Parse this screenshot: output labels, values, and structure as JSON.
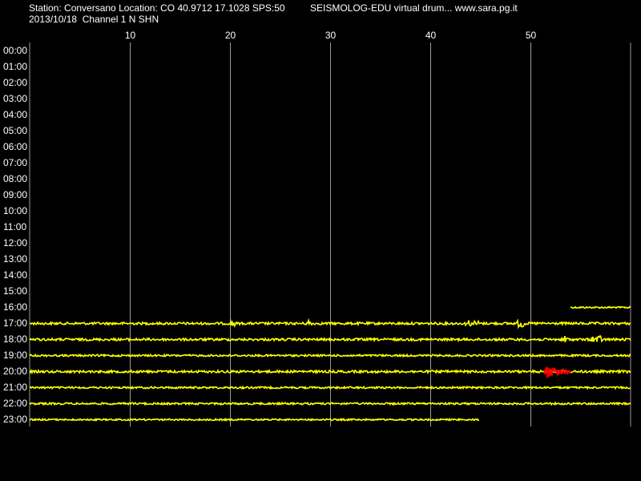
{
  "header": {
    "station_line": "Station: Conversano Location: CO 40.9712 17.1028 SPS:50",
    "date_line": "2013/10/18  Channel 1 N SHN",
    "brand_line": "SEISMOLOG-EDU virtual drum... www.sara.pg.it"
  },
  "colors": {
    "background": "#000000",
    "trace": "#ffff00",
    "event": "#ff0000",
    "grid": "#9a9a9a",
    "text": "#ffffff"
  },
  "chart_data": {
    "type": "line",
    "x_ticks": [
      10,
      20,
      30,
      40,
      50
    ],
    "xlim": [
      0,
      60
    ],
    "hours": [
      "00:00",
      "01:00",
      "02:00",
      "03:00",
      "04:00",
      "05:00",
      "06:00",
      "07:00",
      "08:00",
      "09:00",
      "10:00",
      "11:00",
      "12:00",
      "13:00",
      "14:00",
      "15:00",
      "16:00",
      "17:00",
      "18:00",
      "19:00",
      "20:00",
      "21:00",
      "22:00",
      "23:00"
    ],
    "traces": [
      {
        "hour": "16:00",
        "start": 54.0,
        "end": 60,
        "amplitude": 1.0,
        "spikes": []
      },
      {
        "hour": "17:00",
        "start": 0,
        "end": 60,
        "amplitude": 1.5,
        "spikes": [
          20.3,
          27.9,
          43.8,
          44.6,
          48.9,
          49.2
        ]
      },
      {
        "hour": "18:00",
        "start": 0,
        "end": 60,
        "amplitude": 1.5,
        "spikes": [
          53.5,
          56.3,
          56.6,
          56.9
        ]
      },
      {
        "hour": "19:00",
        "start": 0,
        "end": 60,
        "amplitude": 1.2,
        "spikes": []
      },
      {
        "hour": "20:00",
        "start": 0,
        "end": 60,
        "amplitude": 1.5,
        "spikes": [],
        "event": {
          "start": 51.3,
          "end": 54.0,
          "peak": 51.6
        }
      },
      {
        "hour": "21:00",
        "start": 0,
        "end": 60,
        "amplitude": 1.2,
        "spikes": []
      },
      {
        "hour": "22:00",
        "start": 0,
        "end": 60,
        "amplitude": 1.2,
        "spikes": []
      },
      {
        "hour": "23:00",
        "start": 0,
        "end": 44.9,
        "amplitude": 1.0,
        "spikes": []
      }
    ],
    "grid": true
  }
}
